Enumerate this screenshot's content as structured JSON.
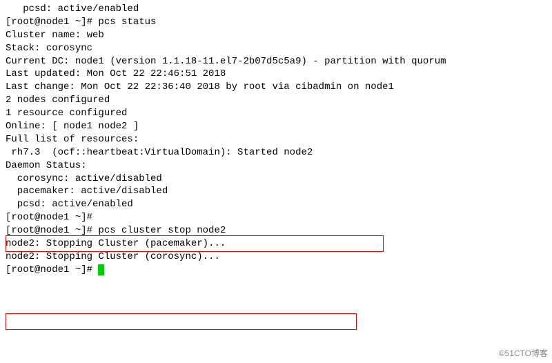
{
  "lines": {
    "l0": "   pcsd: active/enabled",
    "l1": "[root@node1 ~]# pcs status",
    "l2": "Cluster name: web",
    "l3": "Stack: corosync",
    "l4": "Current DC: node1 (version 1.1.18-11.el7-2b07d5c5a9) - partition with quorum",
    "l5": "Last updated: Mon Oct 22 22:46:51 2018",
    "l6": "Last change: Mon Oct 22 22:36:40 2018 by root via cibadmin on node1",
    "l7": "",
    "l8": "2 nodes configured",
    "l9": "1 resource configured",
    "l10": "",
    "l11": "Online: [ node1 node2 ]",
    "l12": "",
    "l13": "Full list of resources:",
    "l14": "",
    "l15": "",
    "l16": "",
    "l17": "",
    "l18": " rh7.3  (ocf::heartbeat:VirtualDomain): Started node2",
    "l19": "",
    "l20": "Daemon Status:",
    "l21": "  corosync: active/disabled",
    "l22": "  pacemaker: active/disabled",
    "l23": "  pcsd: active/enabled",
    "l24": "[root@node1 ~]#",
    "l25": "[root@node1 ~]# pcs cluster stop node2",
    "l26": "node2: Stopping Cluster (pacemaker)...",
    "l27": "node2: Stopping Cluster (corosync)...",
    "l28": "[root@node1 ~]# "
  },
  "watermark": "©51CTO博客"
}
